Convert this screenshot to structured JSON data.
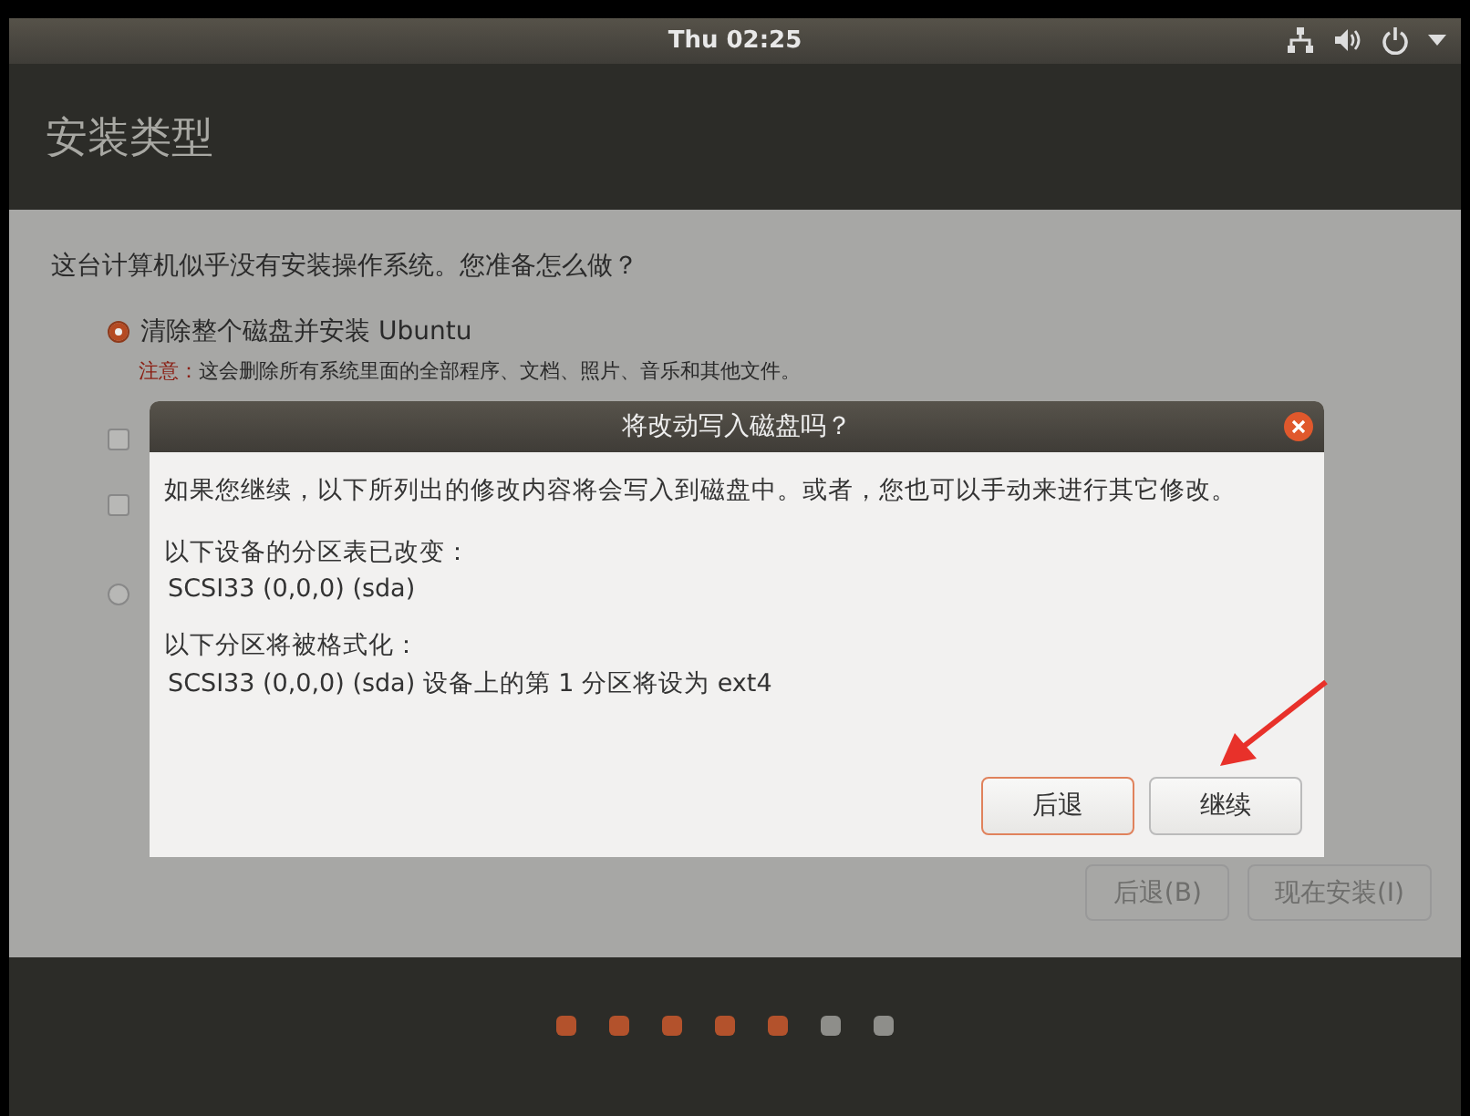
{
  "top_bar": {
    "clock": "Thu 02:25"
  },
  "window": {
    "title": "安装类型"
  },
  "question": "这台计算机似乎没有安装操作系统。您准备怎么做？",
  "options": [
    {
      "kind": "radio",
      "label": "清除整个磁盘并安装 Ubuntu",
      "selected": true,
      "note_label": "注意：",
      "note": "这会删除所有系统里面的全部程序、文档、照片、音乐和其他文件。"
    },
    {
      "kind": "checkbox",
      "checked": false
    },
    {
      "kind": "checkbox",
      "checked": false
    },
    {
      "kind": "radio",
      "selected": false
    }
  ],
  "buttons": [
    {
      "label": "后退(B)",
      "disabled": true
    },
    {
      "label": "现在安装(I)",
      "disabled": true
    }
  ],
  "dialog": {
    "title": "将改动写入磁盘吗？",
    "message": "如果您继续，以下所列出的修改内容将会写入到磁盘中。或者，您也可以手动来进行其它修改。",
    "sections": [
      {
        "heading": "以下设备的分区表已改变：",
        "item": "SCSI33 (0,0,0) (sda)"
      },
      {
        "heading": "以下分区将被格式化：",
        "item": "SCSI33 (0,0,0) (sda) 设备上的第 1 分区将设为 ext4"
      }
    ],
    "buttons": [
      {
        "label": "后退",
        "kind": "default"
      },
      {
        "label": "继续",
        "kind": "normal"
      }
    ]
  },
  "progress_dots": [
    {
      "done": true
    },
    {
      "done": true
    },
    {
      "done": true
    },
    {
      "done": true
    },
    {
      "done": true
    },
    {
      "done": false
    },
    {
      "done": false
    }
  ]
}
